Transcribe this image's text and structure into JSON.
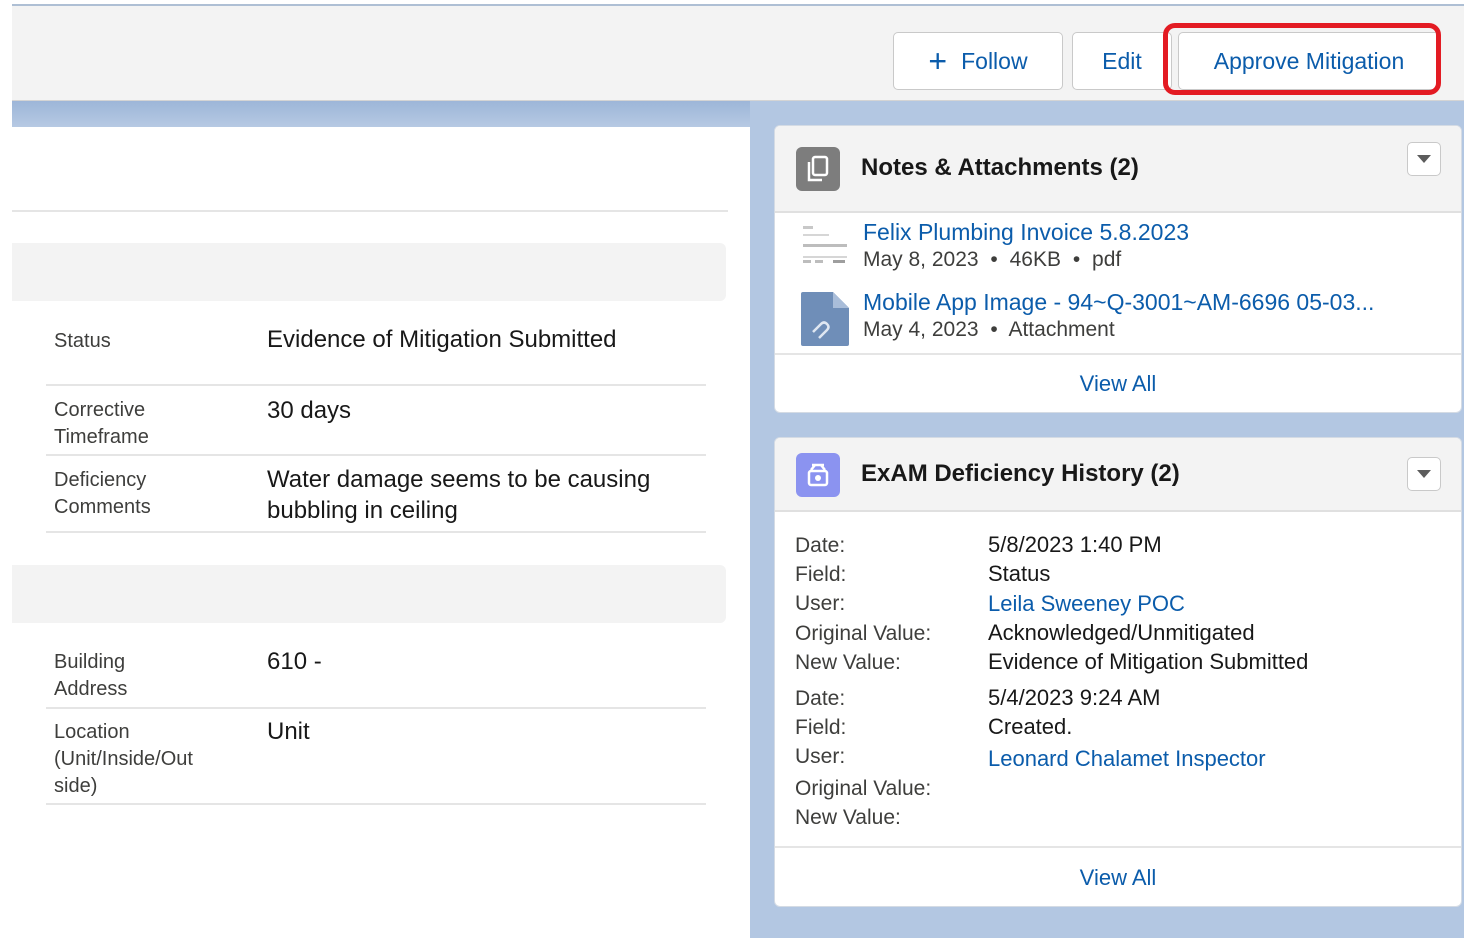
{
  "header": {
    "follow_label": "Follow",
    "edit_label": "Edit",
    "approve_label": "Approve Mitigation",
    "highlight_color": "#e31b23",
    "follow_icon": "plus-icon"
  },
  "details": {
    "fields": [
      {
        "label": "Status",
        "value": "Evidence of Mitigation Submitted"
      },
      {
        "label": "Corrective Timeframe",
        "value": "30 days"
      },
      {
        "label": "Deficiency Comments",
        "value": "Water damage seems to be causing bubbling in ceiling"
      },
      {
        "label": "Building Address",
        "value": "610 -"
      },
      {
        "label": "Location (Unit/Inside/Out side)",
        "value": "Unit"
      }
    ]
  },
  "notes": {
    "title": "Notes & Attachments (2)",
    "icon": "file-icon",
    "files": [
      {
        "name": "Felix Plumbing Invoice 5.8.2023",
        "date": "May 8, 2023",
        "size": "46KB",
        "type": "pdf",
        "thumb": "document-thumbnail"
      },
      {
        "name": "Mobile App Image - 94~Q-3001~AM-6696 05-03...",
        "date": "May 4, 2023",
        "type": "Attachment",
        "thumb": "attachment-icon"
      }
    ],
    "separator": "•",
    "view_all": "View All"
  },
  "history": {
    "title": "ExAM Deficiency History (2)",
    "icon": "history-icon",
    "labels": {
      "date": "Date:",
      "field": "Field:",
      "user": "User:",
      "original": "Original Value:",
      "new": "New Value:"
    },
    "entries": [
      {
        "date": "5/8/2023 1:40 PM",
        "field": "Status",
        "user": "Leila Sweeney POC",
        "original": "Acknowledged/Unmitigated",
        "new": "Evidence of Mitigation Submitted"
      },
      {
        "date": "5/4/2023 9:24 AM",
        "field": "Created.",
        "user": "Leonard Chalamet Inspector",
        "original": "",
        "new": ""
      }
    ],
    "view_all": "View All"
  },
  "colors": {
    "link": "#0b5cab",
    "header_bg": "#f3f3f3",
    "page_bg": "#b3c7e2"
  }
}
